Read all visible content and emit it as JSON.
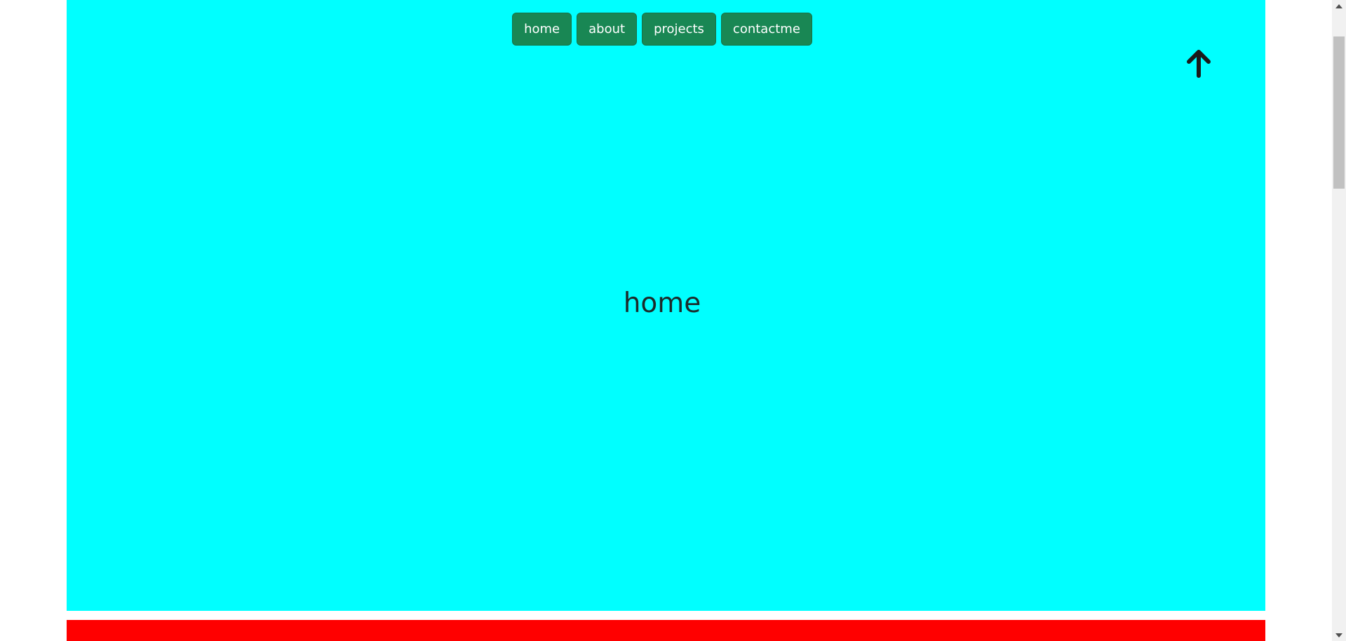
{
  "nav": {
    "items": [
      {
        "label": "home"
      },
      {
        "label": "about"
      },
      {
        "label": "projects"
      },
      {
        "label": "contactme"
      }
    ]
  },
  "hero": {
    "title": "home"
  },
  "icons": {
    "back_to_top": "arrow-up-icon",
    "scroll_up": "triangle-up-icon",
    "scroll_down": "triangle-down-icon"
  },
  "colors": {
    "home_section_bg": "#00ffff",
    "next_section_bg": "#ff0000",
    "nav_button_bg": "#198754",
    "nav_button_text": "#ffffff",
    "page_bg": "#ffffff"
  }
}
